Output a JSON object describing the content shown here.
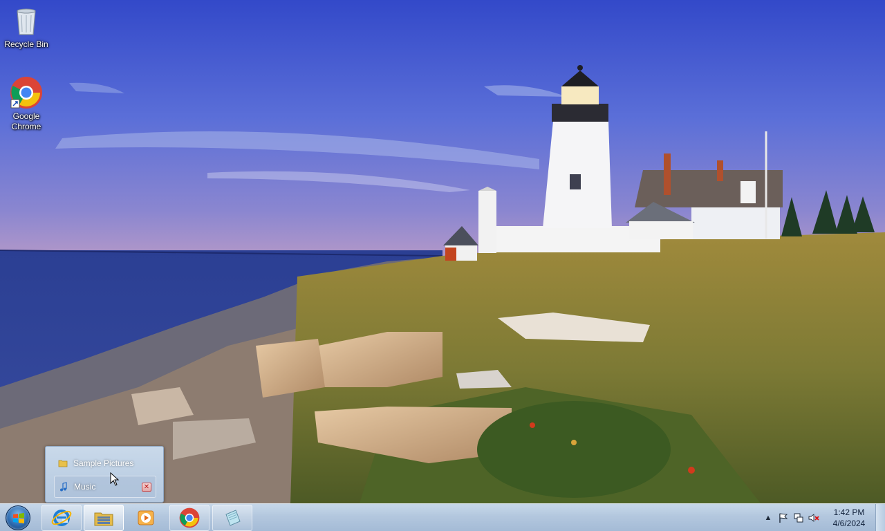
{
  "desktop": {
    "icons": [
      {
        "label": "Recycle Bin",
        "icon": "recycle-bin-icon"
      },
      {
        "label": "Google Chrome",
        "icon": "chrome-icon"
      }
    ]
  },
  "popup": {
    "items": [
      {
        "label": "Sample Pictures",
        "icon": "folder-icon"
      },
      {
        "label": "Music",
        "icon": "music-note-icon"
      }
    ],
    "close_glyph": "✕"
  },
  "taskbar": {
    "pinned": [
      {
        "name": "internet-explorer",
        "icon": "internet-explorer-icon"
      },
      {
        "name": "windows-explorer",
        "icon": "folder-library-icon",
        "active": true
      },
      {
        "name": "media-player",
        "icon": "media-player-icon"
      },
      {
        "name": "chrome",
        "icon": "chrome-icon"
      },
      {
        "name": "notepad",
        "icon": "notepad-icon"
      }
    ],
    "tray": {
      "show_hidden": "▲",
      "clock_time": "1:42 PM",
      "clock_date": "4/6/2024"
    }
  },
  "colors": {
    "sky_top": "#3e5bd0",
    "sea": "#2c3f8e",
    "taskbar": "#b8cbe0"
  }
}
